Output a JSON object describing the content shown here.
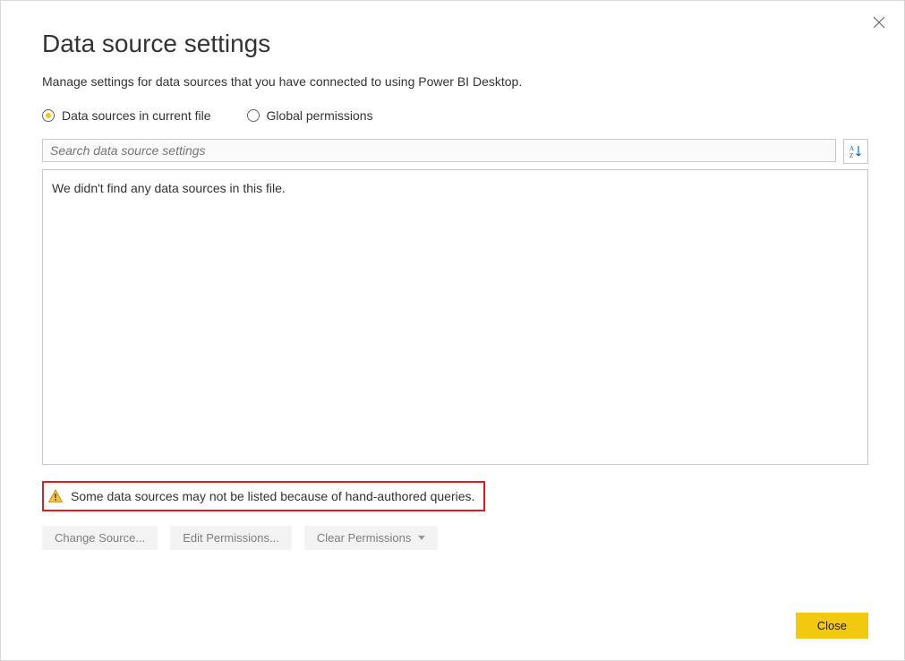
{
  "dialog": {
    "title": "Data source settings",
    "subtitle": "Manage settings for data sources that you have connected to using Power BI Desktop."
  },
  "radio": {
    "current_file": "Data sources in current file",
    "global_perm": "Global permissions",
    "selected": "current_file"
  },
  "search": {
    "placeholder": "Search data source settings"
  },
  "list": {
    "empty_message": "We didn't find any data sources in this file."
  },
  "warning": {
    "text": "Some data sources may not be listed because of hand-authored queries."
  },
  "buttons": {
    "change_source": "Change Source...",
    "edit_permissions": "Edit Permissions...",
    "clear_permissions": "Clear Permissions",
    "close": "Close"
  },
  "icons": {
    "sort": "sort-az",
    "warning": "warning-triangle",
    "close_x": "close"
  }
}
